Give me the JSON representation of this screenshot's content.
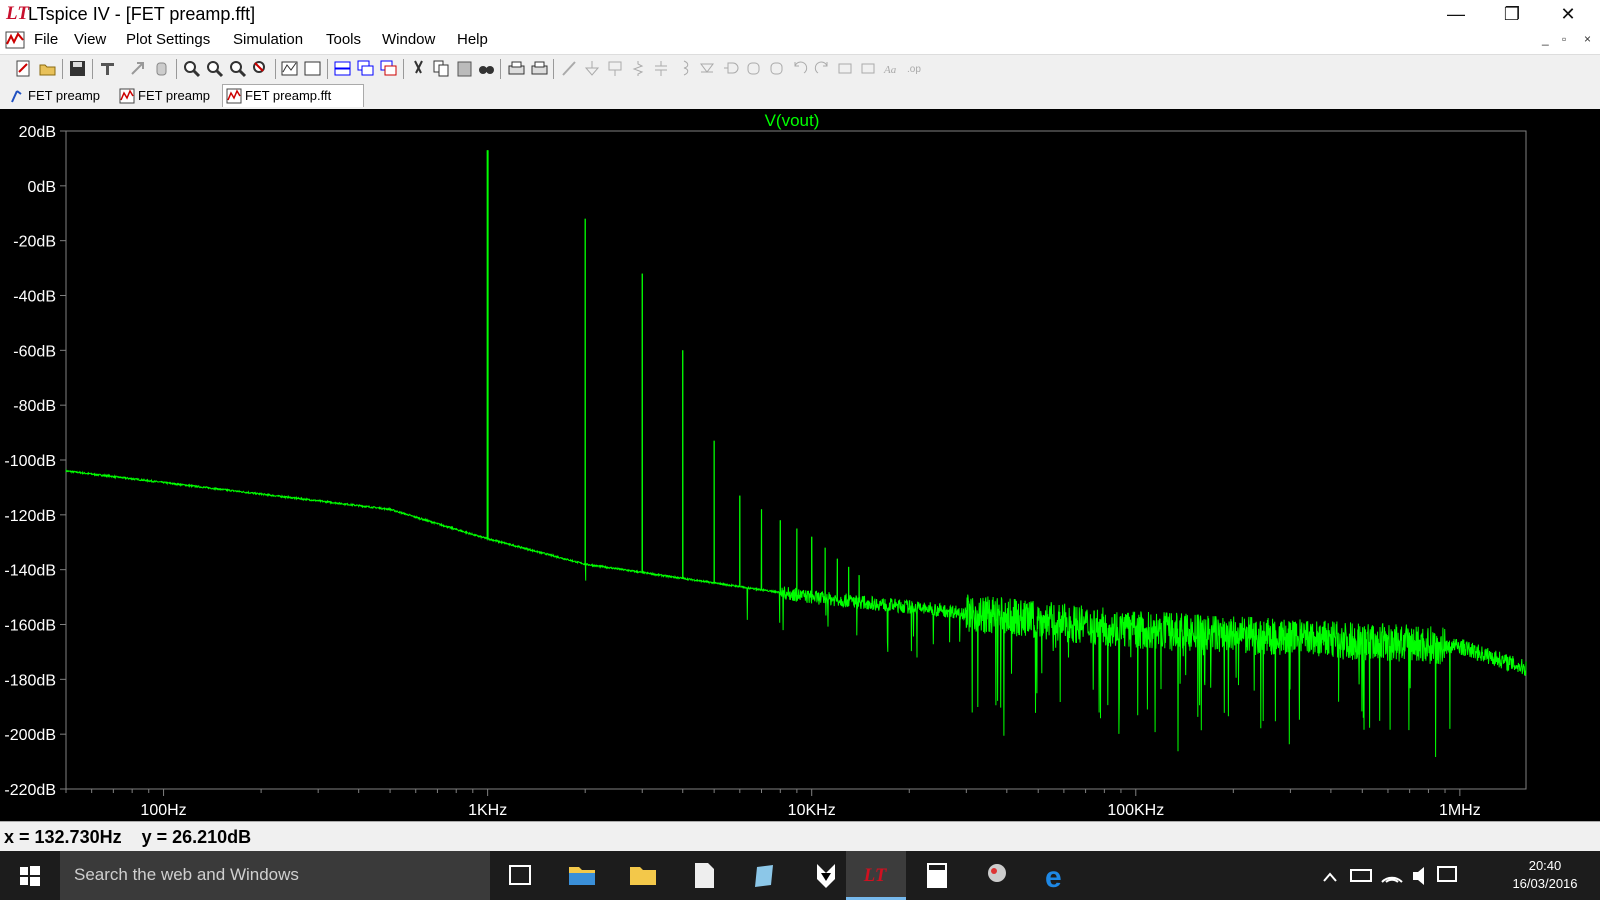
{
  "window": {
    "logo": "LT",
    "title": "LTspice IV - [FET preamp.fft]",
    "minimize": "—",
    "restore": "❐",
    "close": "✕"
  },
  "menu": {
    "items": [
      "File",
      "View",
      "Plot Settings",
      "Simulation",
      "Tools",
      "Window",
      "Help"
    ],
    "mdi": [
      "_",
      "▫",
      "×"
    ]
  },
  "tabs": [
    {
      "label": "FET preamp",
      "icon": "schematic-icon"
    },
    {
      "label": "FET preamp",
      "icon": "waveform-icon"
    },
    {
      "label": "FET preamp.fft",
      "icon": "waveform-icon"
    }
  ],
  "plot": {
    "trace_label": "V(vout)",
    "trace_color": "#00ff00",
    "background": "#000000",
    "axis_color": "#808080"
  },
  "chart_data": {
    "type": "line",
    "title": "V(vout)",
    "xlabel": "",
    "ylabel": "",
    "x_scale": "log",
    "xlim": [
      50,
      1600000
    ],
    "ylim": [
      -220,
      20
    ],
    "yticks": [
      "20dB",
      "0dB",
      "-20dB",
      "-40dB",
      "-60dB",
      "-80dB",
      "-100dB",
      "-120dB",
      "-140dB",
      "-160dB",
      "-180dB",
      "-200dB",
      "-220dB"
    ],
    "ytick_values": [
      20,
      0,
      -20,
      -40,
      -60,
      -80,
      -100,
      -120,
      -140,
      -160,
      -180,
      -200,
      -220
    ],
    "xticks": [
      "100Hz",
      "1KHz",
      "10KHz",
      "100KHz",
      "1MHz"
    ],
    "xtick_values": [
      100,
      1000,
      10000,
      100000,
      1000000
    ],
    "series": [
      {
        "name": "V(vout)",
        "noise_floor": {
          "x": [
            50,
            500,
            950,
            2000,
            10000,
            100000,
            1000000,
            1600000
          ],
          "y": [
            -104,
            -118,
            -128,
            -138,
            -150,
            -162,
            -168,
            -176
          ]
        },
        "harmonics": {
          "x": [
            1000,
            2000,
            3000,
            4000,
            5000,
            6000,
            7000,
            8000,
            9000,
            10000,
            11000,
            12000,
            13000,
            14000
          ],
          "y": [
            13,
            -12,
            -32,
            -60,
            -93,
            -113,
            -118,
            -122,
            -125,
            -128,
            -132,
            -136,
            -139,
            -142
          ]
        }
      }
    ],
    "grid": false,
    "legend": "none"
  },
  "status": {
    "readout": "x = 132.730Hz    y = 26.210dB"
  },
  "taskbar": {
    "search_placeholder": "Search the web and Windows",
    "apps": [
      "task-view-icon",
      "file-explorer-icon",
      "folder-icon",
      "document-icon",
      "app-icon",
      "inkscape-icon",
      "ltspice-icon",
      "calculator-icon",
      "media-icon",
      "edge-icon"
    ],
    "clock_time": "20:40",
    "clock_date": "16/03/2016"
  }
}
